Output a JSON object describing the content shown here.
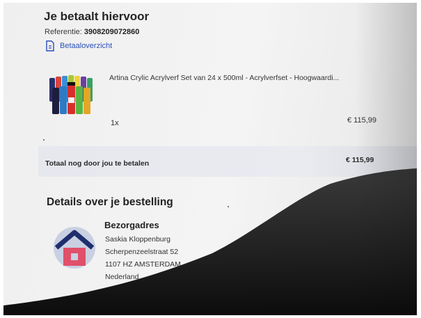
{
  "payment": {
    "title": "Je betaalt hiervoor",
    "reference_label": "Referentie:",
    "reference_value": "3908209072860",
    "overview_link": "Betaaloverzicht"
  },
  "order_item": {
    "title": "Artina Crylic Acrylverf Set van 24 x 500ml - Acrylverfset - Hoogwaardi...",
    "quantity": "1x",
    "price": "€ 115,99",
    "image_icon": "paint-bottles-image"
  },
  "total": {
    "label": "Totaal nog door jou te betalen",
    "value": "€ 115,99"
  },
  "details": {
    "title": "Details over je bestelling",
    "address_heading": "Bezorgadres",
    "address_lines": [
      "Saskia Kloppenburg",
      "Scherpenzeelstraat 52",
      "1107 HZ AMSTERDAM",
      "Nederland"
    ],
    "address_icon": "house-icon"
  },
  "colors": {
    "link": "#2a4fb8",
    "total_band": "#e6e8ee",
    "house_roof": "#1f2f6e",
    "house_body": "#e0506a"
  }
}
